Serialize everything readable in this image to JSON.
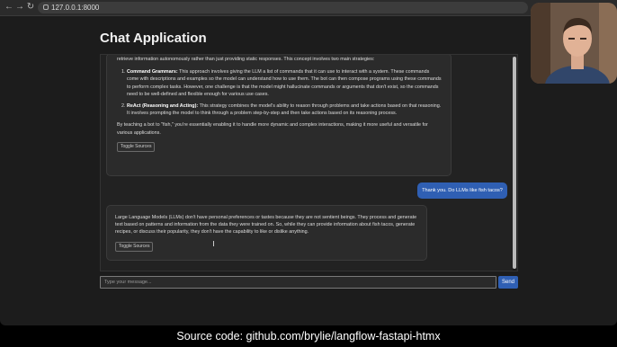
{
  "browser": {
    "url": "127.0.0.1:8000",
    "icons": [
      "back-arrow-icon",
      "forward-arrow-icon",
      "reload-icon",
      "site-info-icon"
    ]
  },
  "app": {
    "title": "Chat Application"
  },
  "messages": {
    "bot_1": {
      "intro": "retrieve information autonomously rather than just providing static responses. This concept involves two main strategies:",
      "items": [
        {
          "term": "Command Grammars:",
          "text": " This approach involves giving the LLM a list of commands that it can use to interact with a system. These commands come with descriptions and examples so the model can understand how to use them. The bot can then compose programs using these commands to perform complex tasks. However, one challenge is that the model might hallucinate commands or arguments that don't exist, so the commands need to be well-defined and flexible enough for various use cases."
        },
        {
          "term": "ReAct (Reasoning and Acting):",
          "text": " This strategy combines the model's ability to reason through problems and take actions based on that reasoning. It involves prompting the model to think through a problem step-by-step and then take actions based on its reasoning process."
        }
      ],
      "outro": "By teaching a bot to \"fish,\" you're essentially enabling it to handle more dynamic and complex interactions, making it more useful and versatile for various applications.",
      "toggle_label": "Toggle Sources"
    },
    "user_1": {
      "text": "Thank you. Do LLMs like fish tacos?"
    },
    "bot_2": {
      "text": "Large Language Models (LLMs) don't have personal preferences or tastes because they are not sentient beings. They process and generate text based on patterns and information from the data they were trained on. So, while they can provide information about fish tacos, generate recipes, or discuss their popularity, they don't have the capability to like or dislike anything.",
      "toggle_label": "Toggle Sources"
    }
  },
  "composer": {
    "placeholder": "Type your message...",
    "send_label": "Send"
  },
  "caption": "Source code: github.com/brylie/langflow-fastapi-htmx",
  "colors": {
    "accent": "#2f5fb3",
    "background": "#1c1c1c",
    "bubble": "#2b2b2b"
  }
}
